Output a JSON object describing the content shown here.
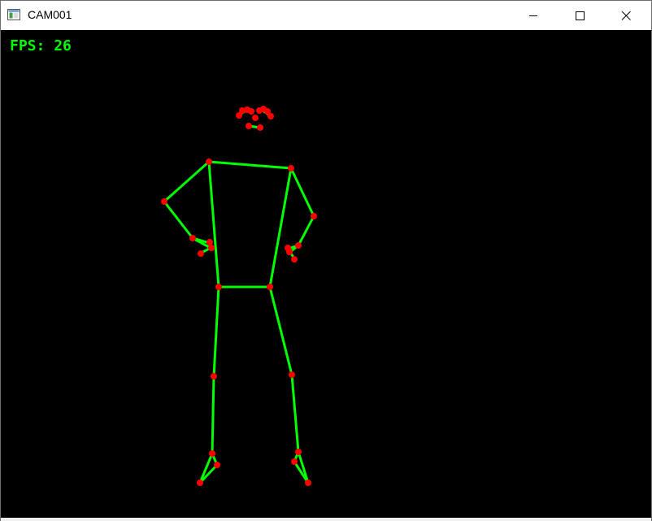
{
  "window": {
    "title": "CAM001",
    "icons": {
      "app": "app-window-icon",
      "minimize": "minimize-icon",
      "maximize": "maximize-icon",
      "close": "close-icon"
    }
  },
  "viewport": {
    "fps_label": "FPS:",
    "fps_value": "26",
    "overlay_color": "#00ff00",
    "background_color": "#000000",
    "skeleton": {
      "bone_color": "#00ff00",
      "joint_color": "#ff0000"
    }
  }
}
